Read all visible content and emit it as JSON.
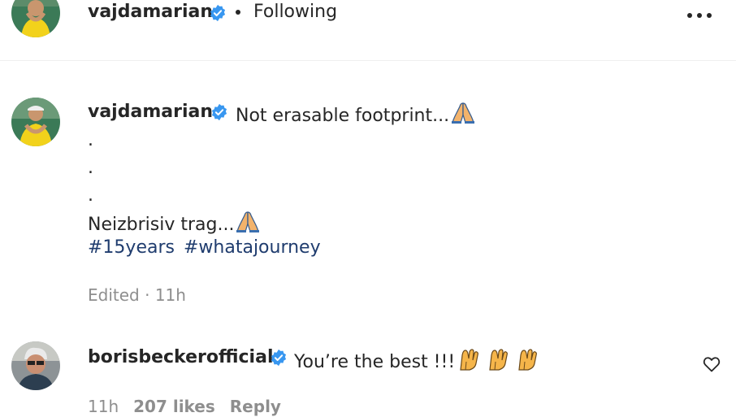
{
  "header": {
    "username": "vajdamarian",
    "separator": "•",
    "follow_status": "Following",
    "more_icon": "more-horizontal-icon"
  },
  "caption": {
    "username": "vajdamarian",
    "text": "Not erasable footprint...",
    "dots": [
      ".",
      ".",
      "."
    ],
    "line2": "Neizbrisiv trag...",
    "hashtags": [
      "#15years",
      "#whatajourney"
    ],
    "edited_label": "Edited",
    "time_sep": " · ",
    "time": "11h",
    "emoji": "folded-hands-emoji"
  },
  "comment": {
    "username": "borisbeckerofficial",
    "text": "You’re the best !!!",
    "emoji": "raising-hands-emoji",
    "emoji_count": 3,
    "time": "11h",
    "likes": "207 likes",
    "reply_label": "Reply",
    "like_icon": "heart-outline-icon"
  },
  "colors": {
    "text": "#262626",
    "secondary": "#8e8e8e",
    "hashtag": "#1f3c6e",
    "verified": "#3897f0",
    "border": "#efefef"
  }
}
